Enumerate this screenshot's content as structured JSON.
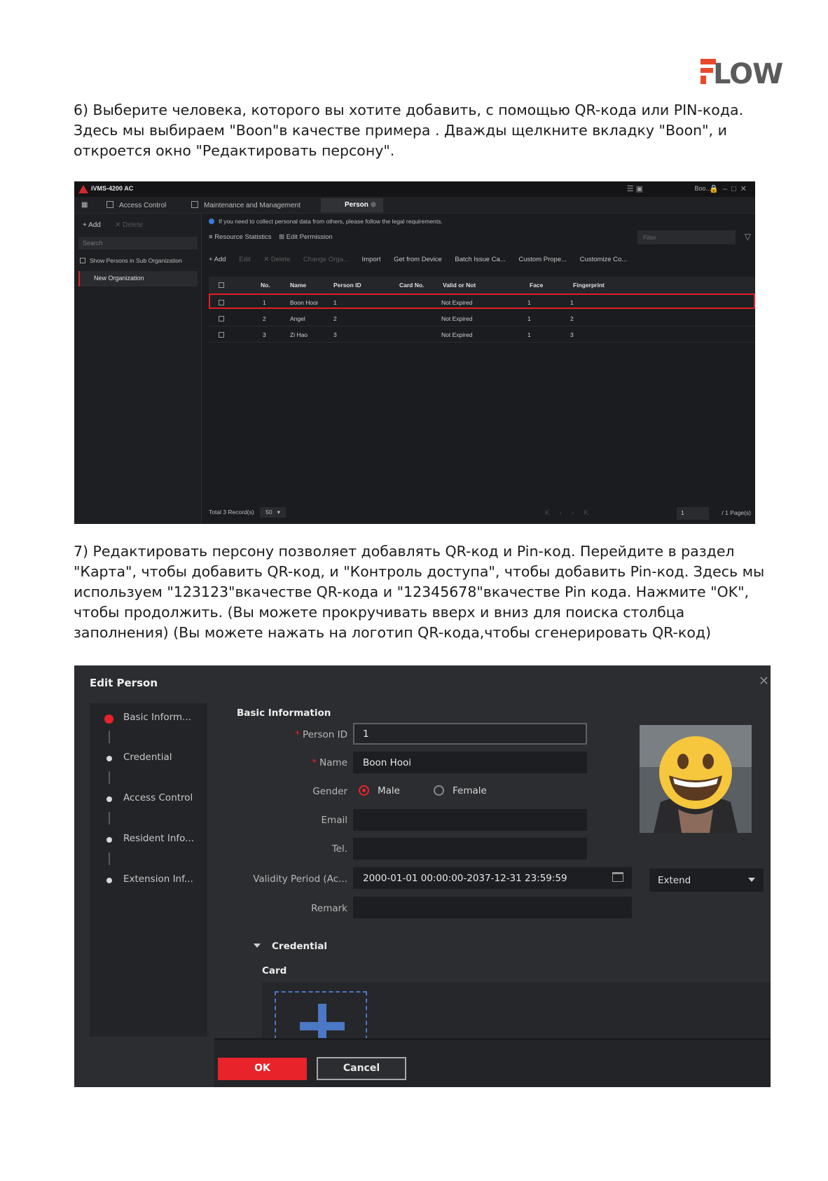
{
  "brand": {
    "logo_text": "FLOW",
    "accent": "#e8492a"
  },
  "step6_text": "6) Выберите человека, которого вы хотите добавить, с помощью QR-кода или PIN-кода. Здесь мы выбираем \"Boon\"в качестве примера . Дважды щелкните вкладку \"Boon\", и откроется окно \"Редактировать персону\".",
  "step7_text": "7) Редактировать персону позволяет добавлять QR-код и Pin-код. Перейдите в раздел \"Карта\", чтобы добавить QR-код, и \"Контроль доступа\", чтобы добавить Pin-код. Здесь мы используем \"123123\"вкачестве QR-кода и \"12345678\"вкачестве Pin кода. Нажмите \"OK\", чтобы продолжить. (Вы можете прокручивать вверх и вниз для поиска столбца заполнения) (Вы можете нажать на логотип QR-кода,чтобы сгенерировать QR-код)",
  "ivms": {
    "app_title": "iVMS-4200 AC",
    "account": "Boo... ▾",
    "tabs": [
      "Access Control",
      "Maintenance and Management",
      "Person"
    ],
    "sidebar": {
      "add": "+ Add",
      "delete": "✕ Delete",
      "search_placeholder": "Search",
      "show_sub": "Show Persons in Sub Organization",
      "org": "New Organization"
    },
    "info": "If you need to collect personal data from others, please follow the legal requirements.",
    "links": {
      "resource": "Resource Statistics",
      "permission": "Edit Permission"
    },
    "filter_placeholder": "Filter",
    "toolbar": {
      "add": "+ Add",
      "edit": "Edit",
      "delete": "✕ Delete",
      "change_org": "Change Orga...",
      "import": "Import",
      "get_device": "Get from Device",
      "batch": "Batch Issue Ca...",
      "custom_prop": "Custom Prope...",
      "customize": "Customize Co..."
    },
    "columns": [
      "No.",
      "Name",
      "Person ID",
      "Card No.",
      "Valid or Not",
      "Face",
      "Fingerprint"
    ],
    "rows": [
      {
        "no": "1",
        "name": "Boon Hooi",
        "person_id": "1",
        "card": "",
        "valid": "Not Expired",
        "face": "1",
        "fingerprint": "1"
      },
      {
        "no": "2",
        "name": "Angel",
        "person_id": "2",
        "card": "",
        "valid": "Not Expired",
        "face": "1",
        "fingerprint": "2"
      },
      {
        "no": "3",
        "name": "Zi Hao",
        "person_id": "3",
        "card": "",
        "valid": "Not Expired",
        "face": "1",
        "fingerprint": "3"
      }
    ],
    "footer": {
      "total": "Total 3 Record(s)",
      "page_size": "50",
      "page": "1",
      "pages": "/ 1 Page(s)"
    }
  },
  "edit_person": {
    "title": "Edit Person",
    "nav": [
      "Basic Inform...",
      "Credential",
      "Access Control",
      "Resident Info...",
      "Extension Inf..."
    ],
    "section": "Basic Information",
    "labels": {
      "person_id": "Person ID",
      "name": "Name",
      "gender": "Gender",
      "email": "Email",
      "tel": "Tel.",
      "validity": "Validity Period (Ac...",
      "remark": "Remark"
    },
    "values": {
      "person_id": "1",
      "name": "Boon Hooi",
      "male": "Male",
      "female": "Female",
      "email": "",
      "tel": "",
      "validity": "2000-01-01 00:00:00-2037-12-31 23:59:59",
      "extend": "Extend",
      "remark": ""
    },
    "credential": "Credential",
    "card": "Card",
    "ok": "OK",
    "cancel": "Cancel"
  }
}
